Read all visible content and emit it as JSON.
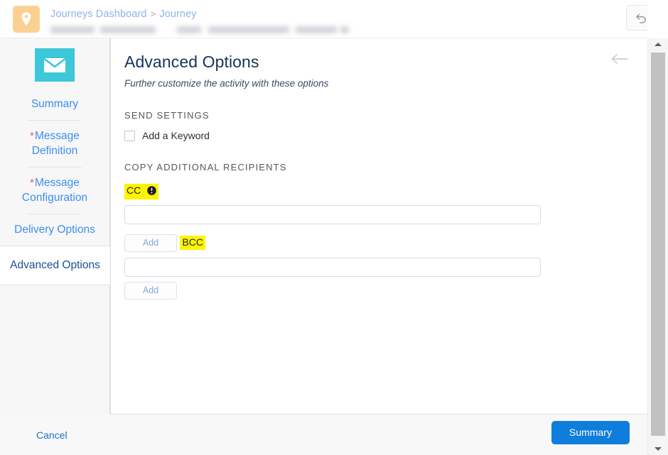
{
  "header": {
    "journey_icon": "location-pin-icon",
    "breadcrumb": {
      "parent": "Journeys Dashboard",
      "separator": ">",
      "current": "Journey"
    },
    "undo_button": "undo-icon"
  },
  "sidebar": {
    "activity_icon": "envelope-icon",
    "items": [
      {
        "label": "Summary",
        "required": false,
        "active": false
      },
      {
        "label": "Message Definition",
        "required": true,
        "required_marker": "*",
        "active": false
      },
      {
        "label": "Message Configuration",
        "required": true,
        "required_marker": "*",
        "active": false
      },
      {
        "label": "Delivery Options",
        "required": false,
        "active": false
      },
      {
        "label": "Advanced Options",
        "required": false,
        "active": true
      }
    ]
  },
  "panel": {
    "title": "Advanced Options",
    "subtitle": "Further customize the activity with these options",
    "collapse_icon": "arrow-left-icon",
    "sections": [
      {
        "heading": "SEND SETTINGS",
        "checkbox": {
          "label": "Add a Keyword",
          "checked": false
        }
      },
      {
        "heading": "COPY ADDITIONAL RECIPIENTS",
        "fields": [
          {
            "label": "CC",
            "highlighted": true,
            "info_icon": "info-circle-icon",
            "value": "",
            "placeholder": "",
            "add_button": "Add"
          },
          {
            "label": "BCC",
            "highlighted": true,
            "info_icon": null,
            "value": "",
            "placeholder": "",
            "add_button": "Add"
          }
        ]
      }
    ]
  },
  "footer": {
    "cancel_label": "Cancel",
    "primary_label": "Summary"
  },
  "colors": {
    "accent_blue": "#0f7ddb",
    "nav_link_blue": "#3d8ef2",
    "active_nav_blue": "#1b5091",
    "required_red": "#e8564d",
    "activity_teal": "#3cc8d8",
    "journey_tile_orange": "#fbd193",
    "highlight_yellow": "#fdf500"
  }
}
